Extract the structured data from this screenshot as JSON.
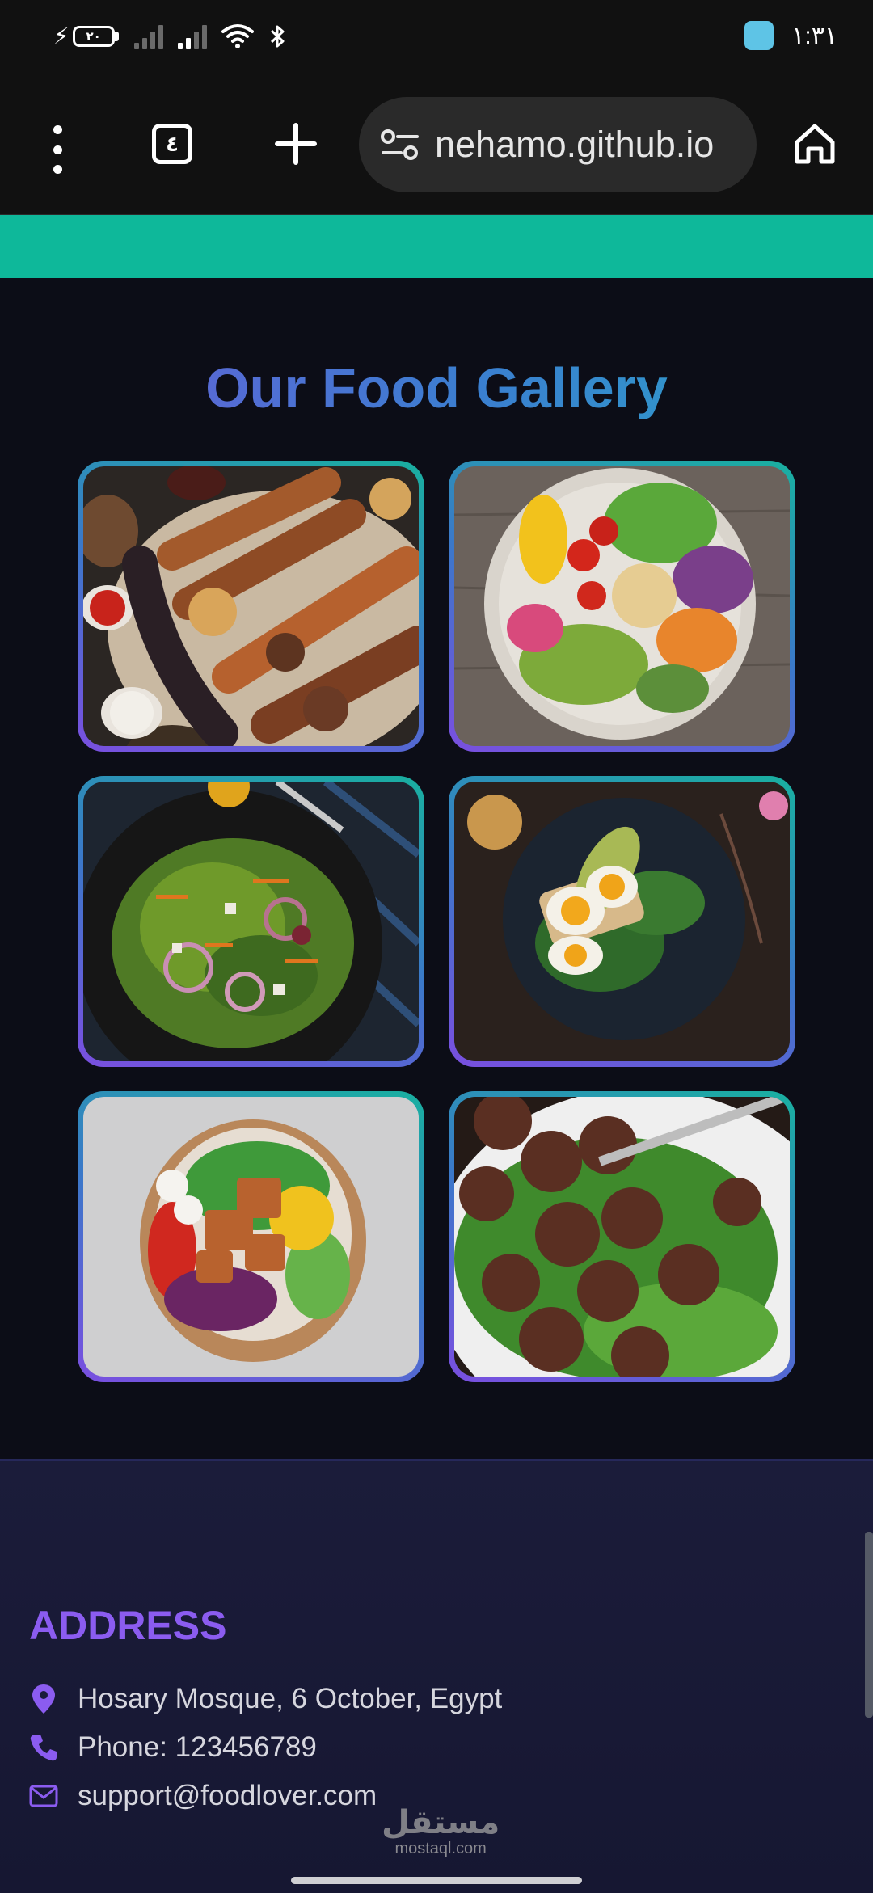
{
  "status_bar": {
    "battery_level": "٢٠",
    "time": "١:٣١"
  },
  "browser": {
    "tab_count": "٤",
    "url": "nehamo.github.io"
  },
  "colors": {
    "banner": "#0eb89a",
    "accent_purple": "#8b5cf0",
    "accent_blue": "#3a7fd0",
    "background": "#0c0d17"
  },
  "gallery": {
    "title": "Our Food Gallery",
    "images": [
      {
        "alt": "grill-platter"
      },
      {
        "alt": "vegetable-bowl"
      },
      {
        "alt": "green-salad"
      },
      {
        "alt": "egg-avocado-toast"
      },
      {
        "alt": "chicken-salad-bowl"
      },
      {
        "alt": "meatballs-plate"
      }
    ]
  },
  "footer": {
    "address_title": "ADDRESS",
    "address": "Hosary Mosque, 6 October, Egypt",
    "phone": "Phone: 123456789",
    "email": "support@foodlover.com"
  },
  "watermark": {
    "arabic": "مستقل",
    "latin": "mostaql.com"
  }
}
